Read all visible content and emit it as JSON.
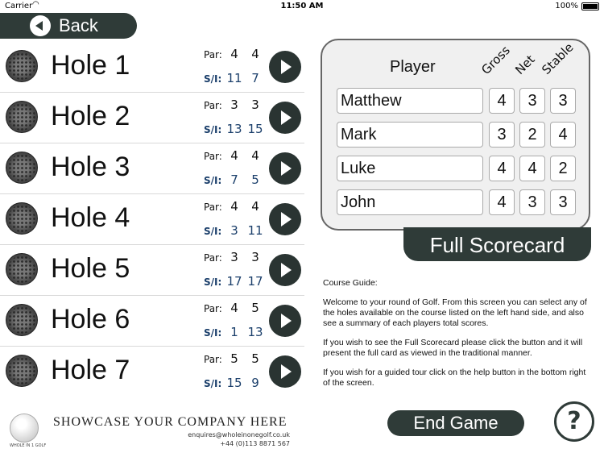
{
  "status_bar": {
    "carrier": "Carrier",
    "time": "11:50 AM",
    "battery": "100%"
  },
  "back_button": {
    "label": "Back"
  },
  "holes": [
    {
      "name": "Hole 1",
      "par_label": "Par:",
      "par": [
        "4",
        "4"
      ],
      "si_label": "S/I:",
      "si": [
        "11",
        "7"
      ]
    },
    {
      "name": "Hole 2",
      "par_label": "Par:",
      "par": [
        "3",
        "3"
      ],
      "si_label": "S/I:",
      "si": [
        "13",
        "15"
      ]
    },
    {
      "name": "Hole 3",
      "par_label": "Par:",
      "par": [
        "4",
        "4"
      ],
      "si_label": "S/I:",
      "si": [
        "7",
        "5"
      ]
    },
    {
      "name": "Hole 4",
      "par_label": "Par:",
      "par": [
        "4",
        "4"
      ],
      "si_label": "S/I:",
      "si": [
        "3",
        "11"
      ]
    },
    {
      "name": "Hole 5",
      "par_label": "Par:",
      "par": [
        "3",
        "3"
      ],
      "si_label": "S/I:",
      "si": [
        "17",
        "17"
      ]
    },
    {
      "name": "Hole 6",
      "par_label": "Par:",
      "par": [
        "4",
        "5"
      ],
      "si_label": "S/I:",
      "si": [
        "1",
        "13"
      ]
    },
    {
      "name": "Hole 7",
      "par_label": "Par:",
      "par": [
        "5",
        "5"
      ],
      "si_label": "S/I:",
      "si": [
        "15",
        "9"
      ]
    }
  ],
  "footer": {
    "showcase": "SHOWCASE YOUR COMPANY HERE",
    "email": "enquires@wholeinonegolf.co.uk",
    "phone": "+44 (0)113 8871 567",
    "logo_text": "WHOLE IN 1 GOLF"
  },
  "scorecard": {
    "player_header": "Player",
    "gross_header": "Gross",
    "net_header": "Net",
    "stable_header": "Stable",
    "players": [
      {
        "name": "Matthew",
        "gross": "4",
        "net": "3",
        "stable": "3"
      },
      {
        "name": "Mark",
        "gross": "3",
        "net": "2",
        "stable": "4"
      },
      {
        "name": "Luke",
        "gross": "4",
        "net": "4",
        "stable": "2"
      },
      {
        "name": "John",
        "gross": "4",
        "net": "3",
        "stable": "3"
      }
    ],
    "full_scorecard_label": "Full Scorecard"
  },
  "guide": {
    "title": "Course Guide:",
    "p1": "Welcome to your round of Golf. From this screen you can select any of the holes available on the course listed on the left hand side, and also see a summary of each players total scores.",
    "p2": "If you wish to see the Full Scorecard please click the button and it will present the full card as viewed in the traditional manner.",
    "p3": "If you wish for a guided tour click on the help button in the bottom right of the screen."
  },
  "end_game_label": "End Game",
  "help_label": "?"
}
